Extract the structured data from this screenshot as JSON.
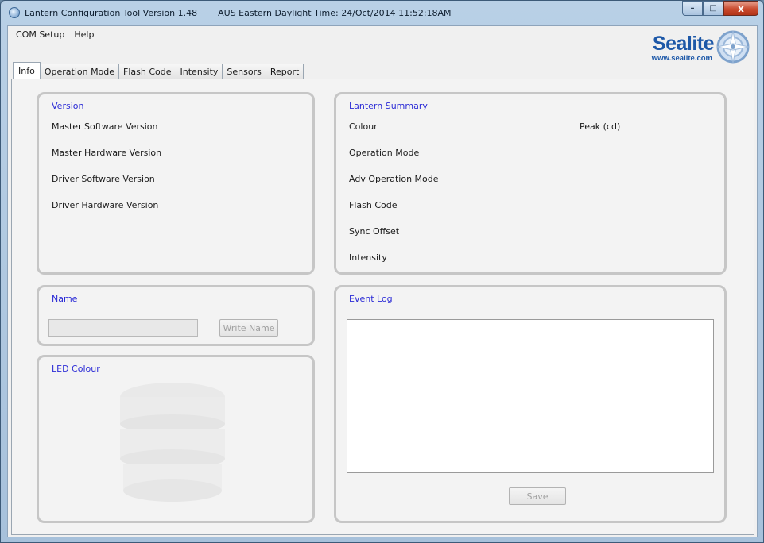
{
  "window": {
    "title": "Lantern Configuration Tool Version 1.48",
    "timestamp": "AUS Eastern Daylight Time: 24/Oct/2014 11:52:18AM",
    "controls": {
      "minimize": "–",
      "maximize": "□",
      "close": "x"
    }
  },
  "menu": {
    "items": [
      "COM Setup",
      "Help"
    ]
  },
  "logo": {
    "brand": "Sealite",
    "url": "www.sealite.com"
  },
  "tabs": [
    "Info",
    "Operation Mode",
    "Flash Code",
    "Intensity",
    "Sensors",
    "Report"
  ],
  "active_tab": "Info",
  "version_group": {
    "title": "Version",
    "labels": [
      "Master Software Version",
      "Master Hardware Version",
      "Driver Software Version",
      "Driver Hardware Version"
    ]
  },
  "summary_group": {
    "title": "Lantern Summary",
    "labels": [
      "Colour",
      "Operation Mode",
      "Adv Operation Mode",
      "Flash Code",
      "Sync Offset",
      "Intensity"
    ],
    "peak_label": "Peak (cd)"
  },
  "name_group": {
    "title": "Name",
    "input_value": "",
    "write_button": "Write Name"
  },
  "led_group": {
    "title": "LED Colour"
  },
  "event_group": {
    "title": "Event Log",
    "log_text": "",
    "save_button": "Save"
  },
  "colors": {
    "group_title": "#2b2bd6",
    "brand_blue": "#1d58a8",
    "close_red": "#c94a2e"
  },
  "icons": [
    "app-icon",
    "minimize-icon",
    "maximize-icon",
    "close-icon",
    "compass-icon"
  ]
}
